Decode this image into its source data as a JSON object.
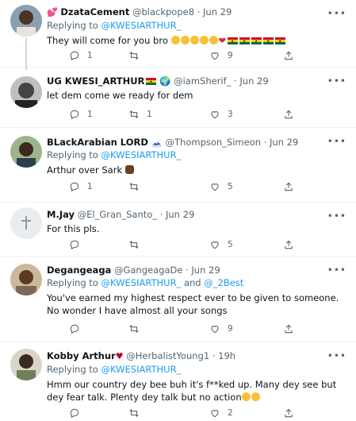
{
  "tweets": [
    {
      "name": "DzataCement",
      "handle": "@blackpope8",
      "sep": "·",
      "time": "Jun 29",
      "reply_prefix": "Replying to ",
      "reply_to": "@KWESIARTHUR_",
      "reply_mid": "",
      "reply_to2": "",
      "text": "They will come for you bro",
      "replies": "1",
      "retweets": "",
      "likes": "9"
    },
    {
      "name": "UG KWESI_ARTHUR",
      "handle": "@iamSherif_",
      "sep": "·",
      "time": "Jun 29",
      "text": "let dem come we ready for dem",
      "replies": "1",
      "retweets": "1",
      "likes": "3"
    },
    {
      "name": "BLackArabian LORD",
      "handle": "@Thompson_Simeon",
      "sep": "·",
      "time": "Jun 29",
      "reply_prefix": "Replying to ",
      "reply_to": "@KWESIARTHUR_",
      "text": "Arthur over Sark",
      "replies": "1",
      "retweets": "",
      "likes": "5"
    },
    {
      "name": "M.Jay",
      "handle": "@El_Gran_Santo_",
      "sep": "·",
      "time": "Jun 29",
      "text": "For this pls.",
      "replies": "",
      "retweets": "",
      "likes": "5"
    },
    {
      "name": "Degangeaga",
      "handle": "@GangeagaDe",
      "sep": "·",
      "time": "Jun 29",
      "reply_prefix": "Replying to ",
      "reply_to": "@KWESIARTHUR_",
      "reply_mid": " and ",
      "reply_to2": "@_2Best",
      "text": "You've earned my highest respect ever to be given to someone. No wonder I have almost all your songs",
      "replies": "",
      "retweets": "",
      "likes": "9"
    },
    {
      "name": "Kobby Arthur",
      "handle": "@HerbalistYoung1",
      "sep": "·",
      "time": "19h",
      "reply_prefix": "Replying to ",
      "reply_to": "@KWESIARTHUR_",
      "text": "Hmm our country dey bee buh it's f**ked up. Many dey see but dey fear talk. Plenty dey talk but no action",
      "replies": "",
      "retweets": "",
      "likes": "2"
    }
  ],
  "icons": {
    "more": "more-icon",
    "reply": "reply-icon",
    "retweet": "retweet-icon",
    "like": "like-icon",
    "share": "share-icon"
  },
  "colors": {
    "link": "#1d9bf0",
    "secondary_text": "#536471",
    "heart": "#d4123f"
  }
}
